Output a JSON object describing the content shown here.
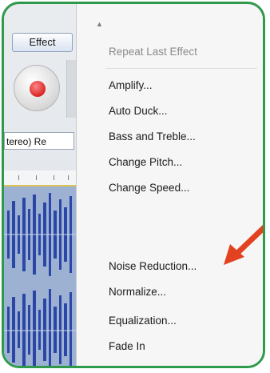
{
  "toolbar": {
    "effect_menu_label": "Effect"
  },
  "track": {
    "label": "tereo) Re"
  },
  "menu": {
    "items": [
      {
        "label": "Repeat Last Effect",
        "enabled": false
      },
      {
        "label": "Amplify...",
        "enabled": true
      },
      {
        "label": "Auto Duck...",
        "enabled": true
      },
      {
        "label": "Bass and Treble...",
        "enabled": true
      },
      {
        "label": "Change Pitch...",
        "enabled": true
      },
      {
        "label": "Change Speed...",
        "enabled": true
      },
      {
        "label": "Noise Reduction...",
        "enabled": true
      },
      {
        "label": "Normalize...",
        "enabled": true
      },
      {
        "label": "Equalization...",
        "enabled": true
      },
      {
        "label": "Fade In",
        "enabled": true
      }
    ]
  },
  "icons": {
    "record": "record-icon",
    "arrow": "annotation-arrow-icon",
    "scroll_up": "scroll-up-arrow-icon"
  },
  "colors": {
    "frame": "#2f9a4c",
    "arrow": "#e2421f",
    "record": "#d82525",
    "waveform": "#2b46a6"
  }
}
